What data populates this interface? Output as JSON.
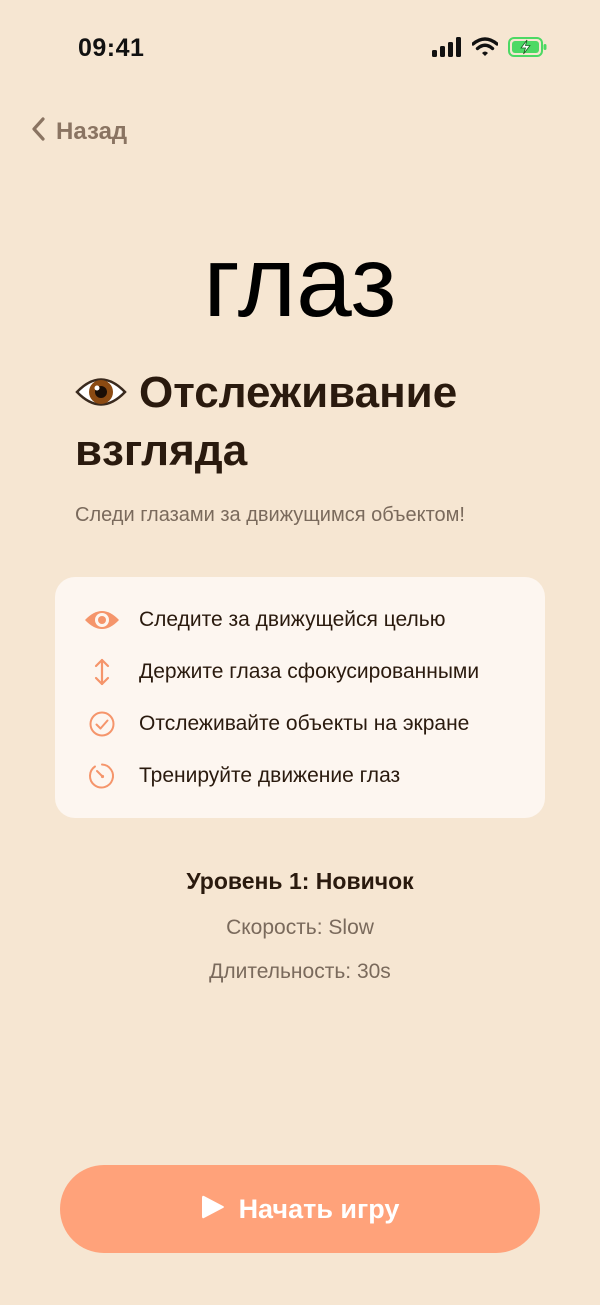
{
  "status_bar": {
    "time": "09:41",
    "icons": [
      "signal-icon",
      "wifi-icon",
      "battery-charging-icon"
    ]
  },
  "nav": {
    "back_label": "Назад",
    "back_icon": "chevron-left-icon"
  },
  "word": "глаз",
  "game": {
    "title_icon": "eye-emoji-icon",
    "title": "Отслеживание взгляда",
    "subtitle": "Следи глазами за движущимся объектом!"
  },
  "tips": [
    {
      "icon": "eye-icon",
      "text": "Следите за движущейся целью"
    },
    {
      "icon": "vertical-arrows-icon",
      "text": "Держите глаза сфокусированными"
    },
    {
      "icon": "check-circle-icon",
      "text": "Отслеживайте объекты на экране"
    },
    {
      "icon": "timer-icon",
      "text": "Тренируйте движение глаз"
    }
  ],
  "level": {
    "title": "Уровень 1: Новичок",
    "speed": "Скорость: Slow",
    "duration": "Длительность: 30s"
  },
  "start_button": {
    "icon": "play-icon",
    "label": "Начать игру"
  },
  "colors": {
    "background": "#F6E6D2",
    "accent": "#FFA27A",
    "card": "#FDF6F0",
    "text_dark": "#2A1A0E",
    "text_muted": "#7A6A5C",
    "battery_green": "#4CD964"
  }
}
